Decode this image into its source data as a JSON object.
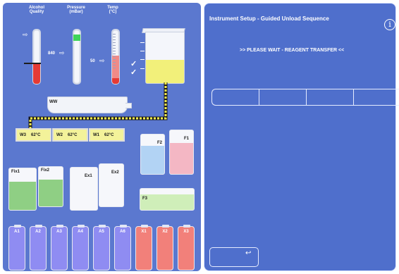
{
  "gauges": {
    "alcohol_label": "Alcohol\nQuality",
    "pressure_label": "Pressure\n(mBar)",
    "temp_label": "Temp\n(°C)",
    "pressure_value": "840",
    "temp_value": "50"
  },
  "ww_label": "WW",
  "warming": [
    {
      "name": "W3",
      "temp": "62°C"
    },
    {
      "name": "W2",
      "temp": "62°C"
    },
    {
      "name": "W1",
      "temp": "62°C"
    }
  ],
  "bottles": {
    "f2": "F2",
    "f1": "F1",
    "fix1": "Fix1",
    "fix2": "Fix2",
    "ex1": "Ex1",
    "ex2": "Ex2",
    "f3": "F3"
  },
  "bottom_bottles": [
    "A1",
    "A2",
    "A3",
    "A4",
    "A5",
    "A6",
    "X1",
    "X2",
    "X3"
  ],
  "right_panel": {
    "title": "Instrument Setup - Guided Unload Sequence",
    "message": ">> PLEASE WAIT - REAGENT TRANSFER <<",
    "info_symbol": "i",
    "back_symbol": "↩"
  },
  "colors": {
    "panel": "#5b78cf",
    "reagent_yellow": "#f2f07a",
    "reagent_blue": "#8f8cf2",
    "reagent_red": "#f2807a",
    "fix_green": "#8fcf84"
  }
}
